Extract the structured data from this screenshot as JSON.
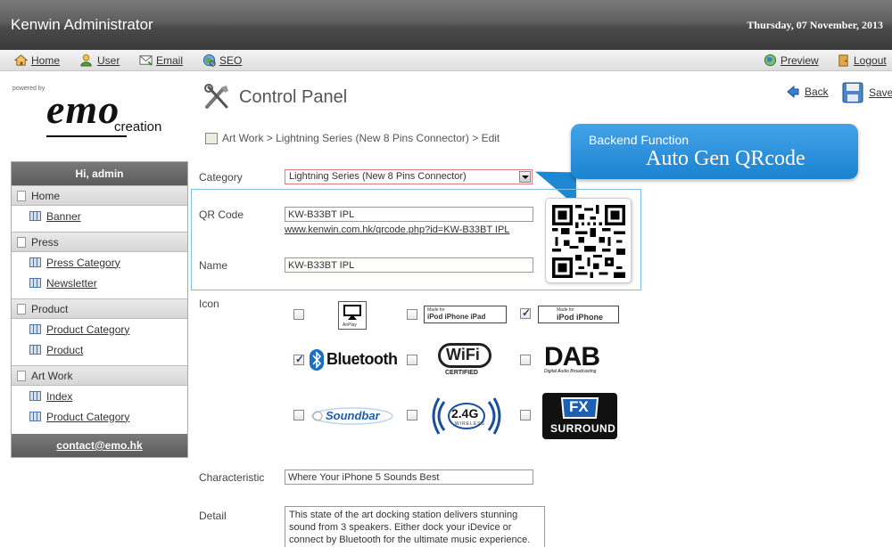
{
  "header": {
    "app_title": "Kenwin Administrator",
    "date": "Thursday, 07 November, 2013"
  },
  "nav": {
    "home": "Home",
    "user": "User",
    "email": "Email",
    "seo": "SEO",
    "preview": "Preview",
    "logout": "Logout"
  },
  "branding": {
    "powered_by": "powered by",
    "logo_word": "emo",
    "logo_sub": "creation"
  },
  "sidebar": {
    "greeting": "Hi, admin",
    "sections": [
      {
        "title": "Home",
        "items": [
          "Banner"
        ]
      },
      {
        "title": "Press",
        "items": [
          "Press Category",
          "Newsletter"
        ]
      },
      {
        "title": "Product",
        "items": [
          "Product Category",
          "Product"
        ]
      },
      {
        "title": "Art Work",
        "items": [
          "Index",
          "Product Category"
        ]
      }
    ],
    "footer": "contact@emo.hk"
  },
  "page": {
    "title": "Control Panel",
    "back": "Back",
    "save": "Save",
    "breadcrumb": "Art Work > Lightning Series (New 8 Pins Connector) > Edit"
  },
  "callout": {
    "line1": "Backend Function",
    "line2": "Auto Gen QRcode"
  },
  "form": {
    "category_label": "Category",
    "category_value": "Lightning Series (New 8 Pins Connector)",
    "qr_label": "QR Code",
    "qr_value": "KW-B33BT IPL",
    "qr_link": "www.kenwin.com.hk/qrcode.php?id=KW-B33BT IPL",
    "name_label": "Name",
    "name_value": "KW-B33BT IPL",
    "icon_label": "Icon",
    "characteristic_label": "Characteristic",
    "characteristic_value": "Where Your iPhone 5 Sounds Best",
    "detail_label": "Detail",
    "detail_value": "This state of the art docking station delivers stunning sound from 3 speakers. Either dock your iDevice or connect by Bluetooth for the ultimate music experience."
  },
  "icons": {
    "airplay": {
      "label": "AirPlay",
      "checked": false
    },
    "made_for_ipod_iphone_ipad": {
      "top": "Made for",
      "label": "iPod iPhone iPad",
      "checked": false
    },
    "made_for_ipod_iphone": {
      "top": "Made for",
      "label": "iPod iPhone",
      "checked": true
    },
    "bluetooth": {
      "label": "Bluetooth",
      "checked": true
    },
    "wifi": {
      "label": "WiFi",
      "sub": "CERTIFIED",
      "checked": false
    },
    "dab": {
      "label": "DAB",
      "sub": "Digital Audio Broadcasting",
      "checked": false
    },
    "soundbar": {
      "label": "Soundbar",
      "checked": false
    },
    "wireless_24g": {
      "label": "2.4G",
      "sub": "WIRELESS",
      "checked": false
    },
    "fx_surround": {
      "label": "FX",
      "sub": "SURROUND",
      "checked": false
    }
  },
  "colors": {
    "accent_blue": "#1b83cf",
    "header_grey": "#4a4a4a",
    "required_border": "#e27b7b",
    "qr_box_border": "#7fc1e6"
  }
}
